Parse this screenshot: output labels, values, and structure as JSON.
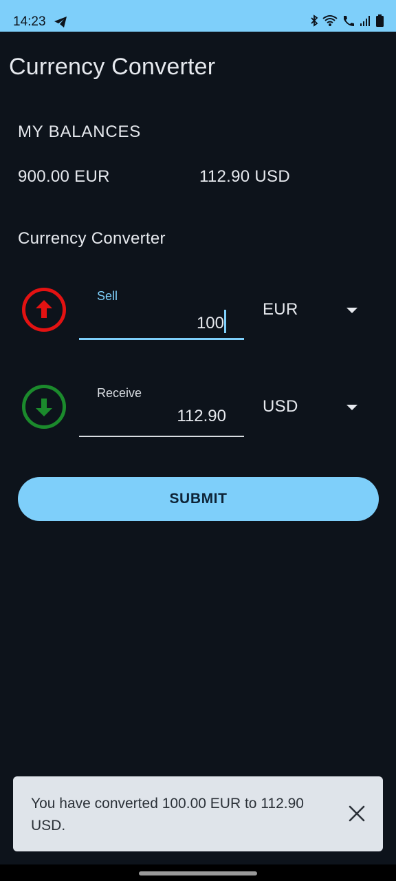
{
  "status_bar": {
    "time": "14:23",
    "icons": [
      "telegram-icon",
      "bluetooth-icon",
      "wifi-icon",
      "call-icon",
      "signal-icon",
      "battery-icon"
    ]
  },
  "app": {
    "title": "Currency Converter"
  },
  "balances": {
    "heading": "MY BALANCES",
    "eur": "900.00 EUR",
    "usd": "112.90 USD"
  },
  "converter": {
    "heading": "Currency Converter",
    "sell": {
      "label": "Sell",
      "value": "100",
      "currency": "EUR",
      "icon_color": "#e31212"
    },
    "receive": {
      "label": "Receive",
      "value": "112.90",
      "currency": "USD",
      "icon_color": "#1b8a2c"
    },
    "submit_label": "SUBMIT"
  },
  "snackbar": {
    "message": "You have converted 100.00 EUR to 112.90 USD."
  },
  "colors": {
    "accent": "#7ecffa",
    "background": "#0d131b"
  }
}
